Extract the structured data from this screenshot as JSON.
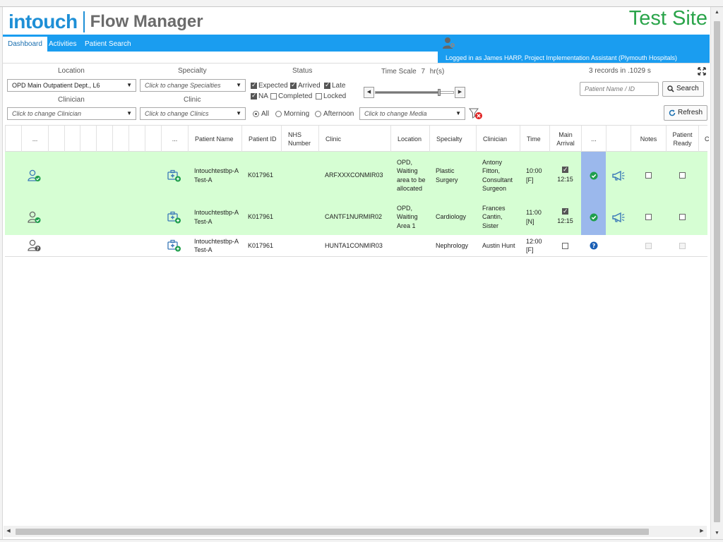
{
  "header": {
    "logo_intouch": "intouch",
    "logo_product": "Flow Manager",
    "site_label": "Test Site",
    "site_color": "#2aa44a",
    "brand_color": "#1e8fd6"
  },
  "nav": {
    "tabs": [
      {
        "label": "Dashboard",
        "active": true
      },
      {
        "label": "Activities",
        "active": false
      },
      {
        "label": "Patient Search",
        "active": false
      }
    ],
    "logged_in": "Logged in as James HARP, Project Implementation Assistant (Plymouth Hospitals)",
    "bar_color": "#1a9df0"
  },
  "filters": {
    "location_label": "Location",
    "location_value": "OPD Main Outpatient Dept., L6",
    "specialty_label": "Specialty",
    "specialty_placeholder": "Click to change Specialties",
    "clinician_label": "Clinician",
    "clinician_placeholder": "Click to change Clinician",
    "clinic_label": "Clinic",
    "clinic_placeholder": "Click to change Clinics",
    "status_label": "Status",
    "status_options": [
      {
        "label": "Expected",
        "checked": true
      },
      {
        "label": "Arrived",
        "checked": true
      },
      {
        "label": "Late",
        "checked": true
      },
      {
        "label": "NA",
        "checked": true
      },
      {
        "label": "Completed",
        "checked": false
      },
      {
        "label": "Locked",
        "checked": false
      }
    ],
    "session_options": [
      {
        "label": "All",
        "selected": true
      },
      {
        "label": "Morning",
        "selected": false
      },
      {
        "label": "Afternoon",
        "selected": false
      }
    ],
    "media_placeholder": "Click to change Media",
    "time_scale_label": "Time Scale",
    "time_scale_value": "7",
    "time_scale_unit": "hr(s)",
    "time_scale_fraction": 0.82,
    "records_text": "3 records in .1029 s",
    "patient_search_placeholder": "Patient Name / ID",
    "search_label": "Search",
    "refresh_label": "Refresh"
  },
  "table": {
    "headers": {
      "col_dots1": "...",
      "col_dots2": "...",
      "patient_name": "Patient Name",
      "patient_id": "Patient ID",
      "nhs_number": "NHS Number",
      "clinic": "Clinic",
      "location": "Location",
      "specialty": "Specialty",
      "clinician": "Clinician",
      "time": "Time",
      "main_arrival": "Main Arrival",
      "col_dots3": "...",
      "notes": "Notes",
      "patient_ready": "Patient Ready",
      "col_cut": "C"
    },
    "rows": [
      {
        "patient_name": "Intouchtestbp-A Test-A",
        "patient_id": "K017961",
        "nhs_number": "",
        "clinic": "ARFXXXCONMIR03",
        "location": "OPD, Waiting area to be allocated",
        "specialty": "Plastic Surgery",
        "clinician": "Antony Fitton, Consultant Surgeon",
        "time": "10:00 [F]",
        "arrival_checked": true,
        "arrival_time": "12:15",
        "status": "arrived",
        "notes_checked": false,
        "ready_checked": false,
        "row_color": "green"
      },
      {
        "patient_name": "Intouchtestbp-A Test-A",
        "patient_id": "K017961",
        "nhs_number": "",
        "clinic": "CANTF1NURMIR02",
        "location": "OPD, Waiting Area 1",
        "specialty": "Cardiology",
        "clinician": "Frances Cantin, Sister",
        "time": "11:00 [N]",
        "arrival_checked": true,
        "arrival_time": "12:15",
        "status": "arrived",
        "notes_checked": false,
        "ready_checked": false,
        "row_color": "green"
      },
      {
        "patient_name": "Intouchtestbp-A Test-A",
        "patient_id": "K017961",
        "nhs_number": "",
        "clinic": "HUNTA1CONMIR03",
        "location": "",
        "specialty": "Nephrology",
        "clinician": "Austin Hunt",
        "time": "12:00 [F]",
        "arrival_checked": false,
        "arrival_time": "",
        "status": "unknown",
        "notes_checked": false,
        "ready_checked": false,
        "row_color": "white"
      }
    ],
    "row_green": "#d6fed3",
    "highlight_blue": "#9bb8ec"
  },
  "icons": {
    "person_ok": "person-check-icon",
    "person_unknown": "person-question-icon",
    "medical_case": "medical-case-add-icon",
    "check_circle": "check-circle-icon",
    "question_circle": "question-circle-icon",
    "megaphone": "megaphone-icon",
    "filter_clear": "filter-clear-icon",
    "fullscreen": "fullscreen-icon",
    "refresh": "refresh-icon",
    "search": "search-icon"
  }
}
